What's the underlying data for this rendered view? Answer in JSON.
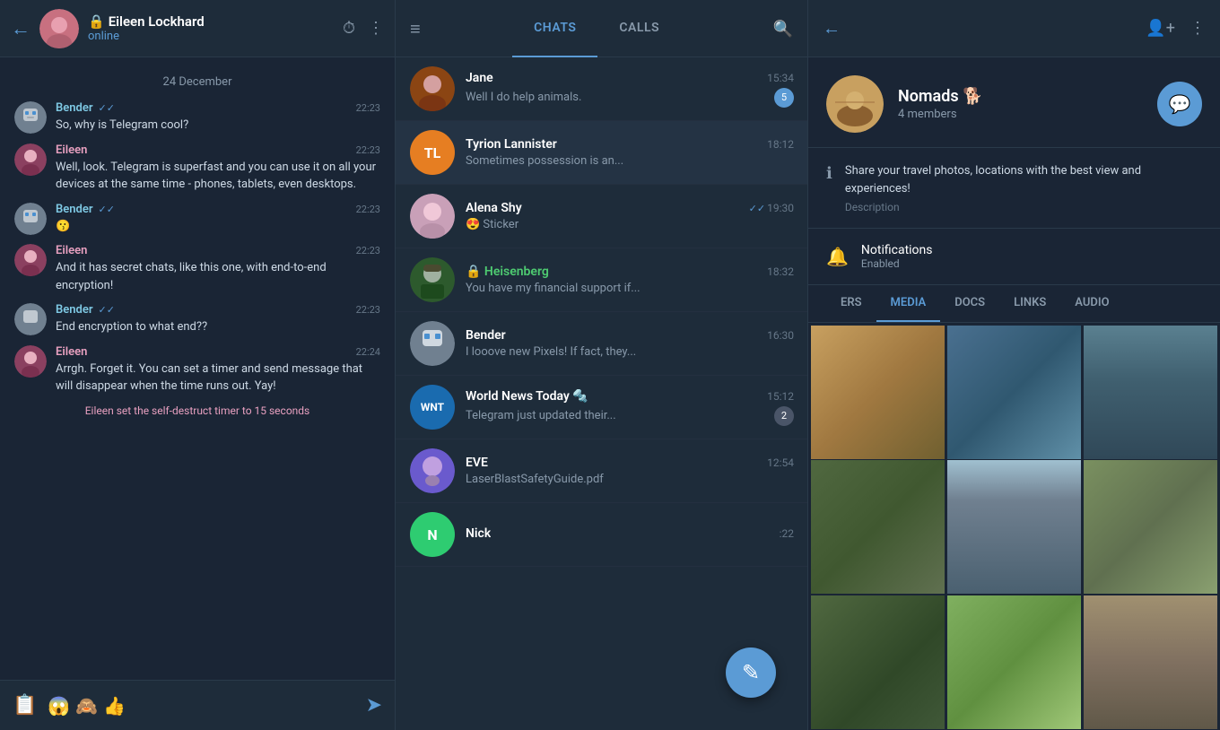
{
  "topbar": {
    "back_label": "←",
    "user": {
      "name": "Eileen Lockhard",
      "status": "online",
      "lock": "🔒"
    },
    "timer_icon": "⏱",
    "more_icon": "⋮",
    "hamburger_icon": "≡",
    "tabs": [
      {
        "label": "CHATS",
        "active": true
      },
      {
        "label": "CALLS",
        "active": false
      }
    ],
    "search_icon": "🔍",
    "right_back": "←",
    "add_user_icon": "👤+",
    "right_more": "⋮"
  },
  "chat": {
    "date_divider": "24 December",
    "messages": [
      {
        "sender": "Bender",
        "sender_class": "bender",
        "time": "22:23",
        "check": "✓✓",
        "text": "So, why is Telegram cool?"
      },
      {
        "sender": "Eileen",
        "sender_class": "eileen",
        "time": "22:23",
        "text": "Well, look. Telegram is superfast and you can use it on all your devices at the same time - phones, tablets, even desktops."
      },
      {
        "sender": "Bender",
        "sender_class": "bender",
        "time": "22:23",
        "check": "✓✓",
        "text": "😗"
      },
      {
        "sender": "Eileen",
        "sender_class": "eileen",
        "time": "22:23",
        "text": "And it has secret chats, like this one, with end-to-end encryption!"
      },
      {
        "sender": "Bender",
        "sender_class": "bender",
        "time": "22:23",
        "check": "✓✓",
        "text": "End encryption to what end??"
      },
      {
        "sender": "Eileen",
        "sender_class": "eileen",
        "time": "22:24",
        "text": "Arrgh. Forget it. You can set a timer and send message that will disappear when the time runs out. Yay!"
      }
    ],
    "system_message": "Eileen set the self-destruct timer to 15 seconds",
    "bottom_emojis": [
      "😱",
      "🙈",
      "👍"
    ],
    "send_icon": "➤",
    "sticker_icon": "🗒"
  },
  "chat_list": {
    "items": [
      {
        "name": "Jane",
        "time": "15:34",
        "preview": "Well I do help animals.",
        "badge": "5",
        "badge_type": "blue",
        "avatar_color": "#c0392b",
        "avatar_text": "",
        "has_image": true,
        "image_color": "#8B4513"
      },
      {
        "name": "Tyrion Lannister",
        "time": "18:12",
        "preview": "Sometimes possession is an...",
        "badge": "",
        "avatar_color": "#e67e22",
        "avatar_text": "TL",
        "has_image": false
      },
      {
        "name": "Alena Shy",
        "time": "19:30",
        "preview": "😍 Sticker",
        "badge": "",
        "check": "✓✓",
        "avatar_color": "#d4a0c0",
        "avatar_text": "",
        "has_image": true,
        "image_color": "#c9a0b8"
      },
      {
        "name": "Heisenberg",
        "time": "18:32",
        "preview": "You have my financial support if...",
        "badge": "",
        "name_class": "green",
        "lock": "🔒",
        "avatar_color": "#2d5a2d",
        "avatar_text": "",
        "has_image": true,
        "image_color": "#2d5a2d"
      },
      {
        "name": "Bender",
        "time": "16:30",
        "preview": "I looove new Pixels! If fact, they...",
        "badge": "",
        "avatar_color": "#708090",
        "avatar_text": "",
        "has_image": true,
        "image_color": "#708090"
      },
      {
        "name": "World News Today 🔩",
        "time": "15:12",
        "preview": "Telegram just updated their...",
        "badge": "2",
        "badge_type": "grey",
        "avatar_color": "#1a6baf",
        "avatar_text": "WNT",
        "has_image": false
      },
      {
        "name": "EVE",
        "time": "12:54",
        "preview": "LaserBlastSafetyGuide.pdf",
        "badge": "",
        "avatar_color": "#6a5acd",
        "avatar_text": "",
        "has_image": true,
        "image_color": "#9b59b6"
      },
      {
        "name": "Nick",
        "time": "— :22",
        "preview": "",
        "badge": "",
        "avatar_color": "#2ecc71",
        "avatar_text": "N",
        "has_image": false
      }
    ],
    "fab_icon": "✎"
  },
  "detail": {
    "group_name": "Nomads 🐕",
    "group_members": "4 members",
    "description": "Share your travel photos, locations with the best view and experiences!",
    "description_label": "Description",
    "notifications_title": "Notifications",
    "notifications_status": "Enabled",
    "media_tabs": [
      {
        "label": "ERS",
        "active": false
      },
      {
        "label": "MEDIA",
        "active": true
      },
      {
        "label": "DOCS",
        "active": false
      },
      {
        "label": "LINKS",
        "active": false
      },
      {
        "label": "AUDIO",
        "active": false
      }
    ],
    "media_colors": [
      "#c8a060",
      "#4a90a0",
      "#5a7090",
      "#6a8040",
      "#7090a0",
      "#8a9070",
      "#607050",
      "#80a060",
      "#a09070"
    ],
    "fab_chat_icon": "💬"
  }
}
